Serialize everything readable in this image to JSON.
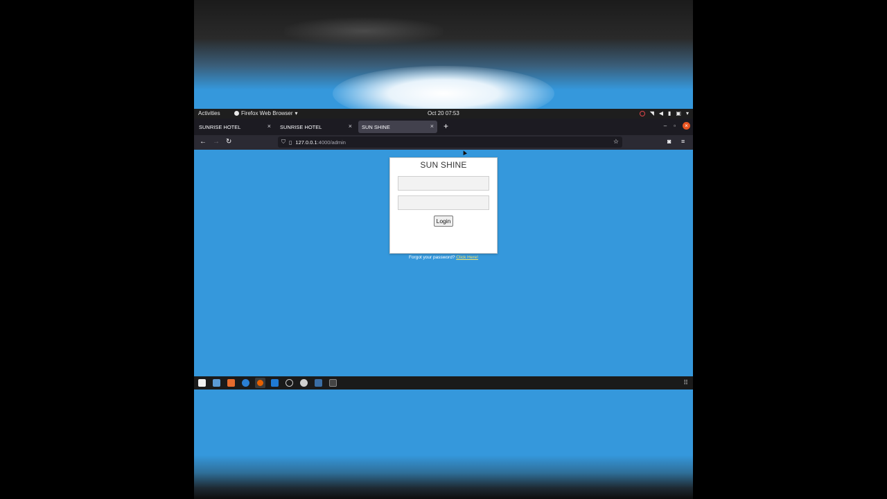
{
  "topbar": {
    "activities": "Activities",
    "app_name": "Firefox Web Browser",
    "clock": "Oct 20  07:53"
  },
  "tabs": [
    {
      "label": "SUNRISE HOTEL",
      "active": false
    },
    {
      "label": "SUNRISE HOTEL",
      "active": false
    },
    {
      "label": "SUN SHINE",
      "active": true
    }
  ],
  "navbar": {
    "url_host": "127.0.0.1",
    "url_path": ":4000/admin"
  },
  "login": {
    "title": "SUN SHINE",
    "username_value": "",
    "password_value": "",
    "button_label": "Login",
    "forgot_text": "Forgot your password?",
    "forgot_link": "Click Here!"
  },
  "icons": {
    "firefox": "firefox-icon",
    "close": "close-icon",
    "new_tab": "plus-icon",
    "back": "back-arrow-icon",
    "forward": "forward-arrow-icon",
    "reload": "reload-icon",
    "shield": "shield-icon",
    "page": "page-icon",
    "star": "star-icon",
    "pocket": "pocket-icon",
    "menu": "hamburger-menu-icon"
  },
  "colors": {
    "page_background": "#3598dc",
    "forgot_link": "#f3e36a",
    "window_close": "#e95420"
  }
}
